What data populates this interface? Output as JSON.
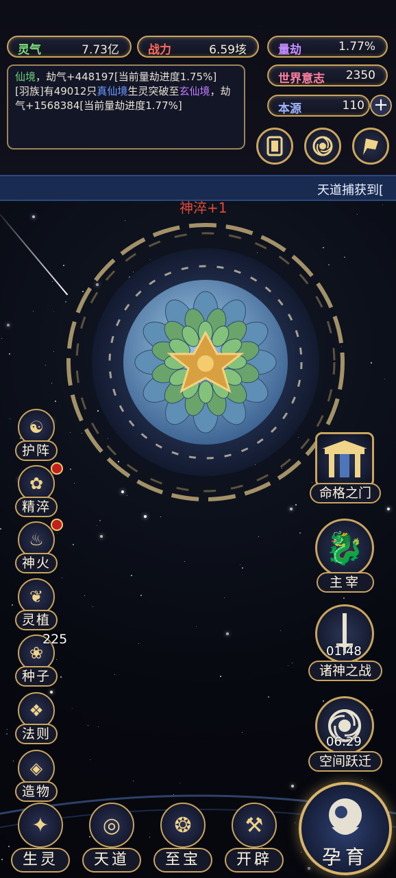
{
  "resources": {
    "lingqi": {
      "label": "灵气",
      "value": "7.73亿",
      "color": "#7be07a"
    },
    "zhanli": {
      "label": "战力",
      "value": "6.59垓",
      "color": "#ff6a5a"
    },
    "liangjie": {
      "label": "量劫",
      "value": "1.77%",
      "color": "#c48cff"
    },
    "shijie": {
      "label": "世界意志",
      "value": "2350",
      "color": "#ff80a0"
    },
    "benyuan": {
      "label": "本源",
      "value": "110",
      "color": "#9db4ff"
    }
  },
  "log": {
    "line1_a": "仙境",
    "line1_b": "，劫气+448197[当前量劫进度1.75%]",
    "line2_a": "[羽族]有49012只",
    "line2_b": "真仙境",
    "line2_c": "生灵突破至",
    "line2_d": "玄仙境",
    "line2_e": "，劫气+1568384[当前量劫进度1.77%]"
  },
  "ticker": "天道捕获到[",
  "float_text": "神淬+1",
  "seed_count": "225",
  "side_buttons": [
    "护阵",
    "精淬",
    "神火",
    "灵植",
    "种子",
    "法则",
    "造物"
  ],
  "right_buttons": {
    "mingge": "命格之门",
    "zhuzai": "主宰",
    "zhushen": "诸神之战",
    "zhushen_timer": "01:48",
    "kongjian": "空间跃迁",
    "kongjian_timer": "06:29"
  },
  "bottom_buttons": [
    "生灵",
    "天道",
    "至宝",
    "开辟"
  ],
  "main_button": "孕育",
  "colors": {
    "gold": "#c9a55e",
    "accent_red": "#c0201e"
  }
}
